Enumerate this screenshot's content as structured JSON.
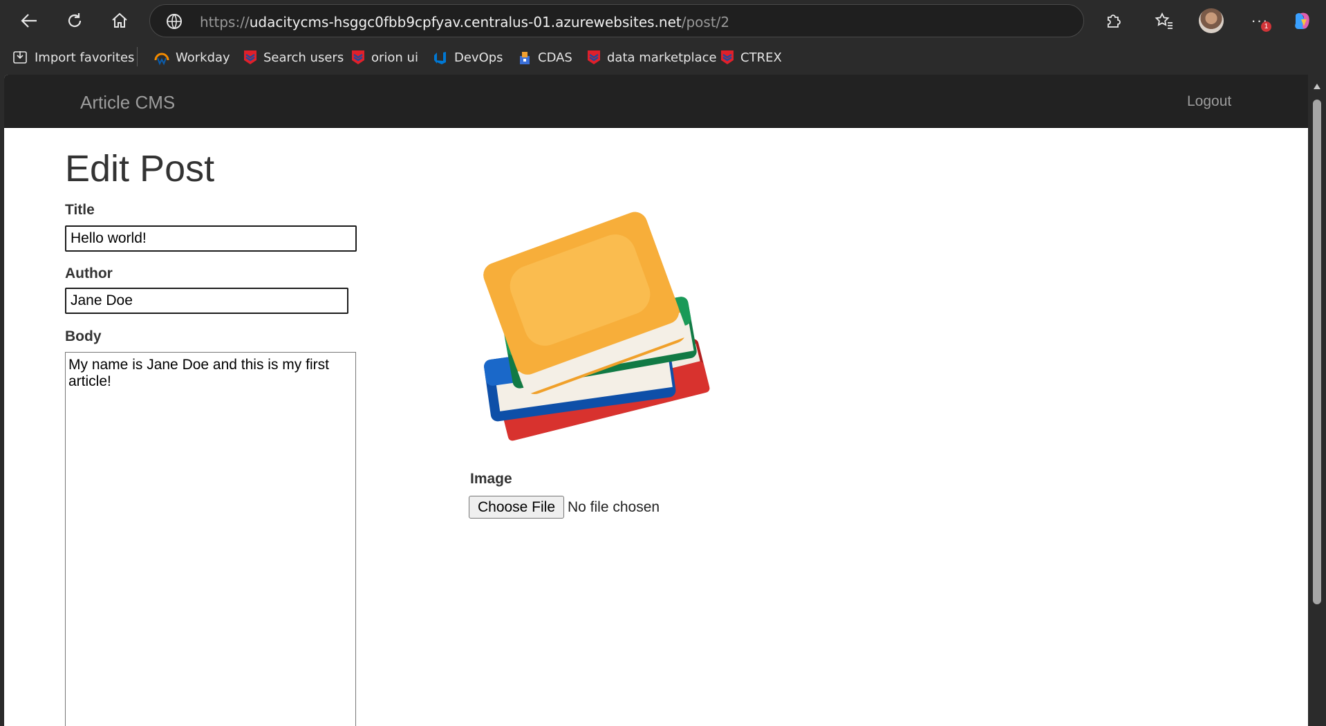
{
  "browser": {
    "url_scheme": "https://",
    "url_host": "udacitycms-hsggc0fbb9cpfyav.centralus-01.azurewebsites.net",
    "url_path": "/post/2",
    "notification_count": "1",
    "bookmarks": [
      {
        "label": "Import favorites",
        "icon": "import-icon"
      },
      {
        "label": "Workday",
        "icon": "workday-icon",
        "color": "#f38b00"
      },
      {
        "label": "Search users",
        "icon": "chevron-logo-icon",
        "color": "#e0202a"
      },
      {
        "label": "orion ui",
        "icon": "chevron-logo-icon",
        "color": "#e0202a"
      },
      {
        "label": "DevOps",
        "icon": "devops-icon",
        "color": "#0078d4"
      },
      {
        "label": "CDAS",
        "icon": "cdas-icon",
        "color": "#3a6fd8"
      },
      {
        "label": "data marketplace",
        "icon": "chevron-logo-icon",
        "color": "#e0202a"
      },
      {
        "label": "CTREX",
        "icon": "chevron-logo-icon",
        "color": "#e0202a"
      }
    ]
  },
  "app": {
    "brand": "Article CMS",
    "logout": "Logout"
  },
  "form": {
    "heading": "Edit Post",
    "title_label": "Title",
    "title_value": "Hello world!",
    "author_label": "Author",
    "author_value": "Jane Doe",
    "body_label": "Body",
    "body_value": "My name is Jane Doe and this is my first article!",
    "image_label": "Image",
    "choose_file": "Choose File",
    "file_status": "No file chosen"
  }
}
